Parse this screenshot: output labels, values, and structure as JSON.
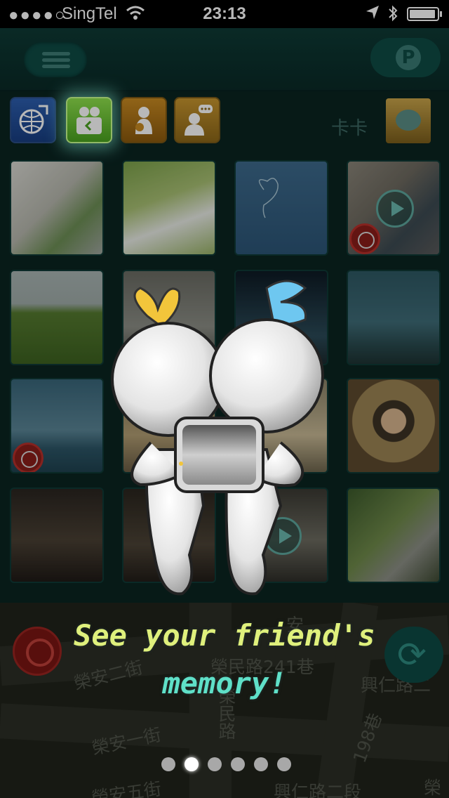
{
  "status_bar": {
    "signal": "●●●●○",
    "carrier": "SingTel",
    "time": "23:13"
  },
  "header": {
    "username": "卡卡"
  },
  "tabs": [
    {
      "name": "world"
    },
    {
      "name": "friends",
      "selected": true
    },
    {
      "name": "profile"
    },
    {
      "name": "chat"
    }
  ],
  "map": {
    "streets": [
      "榮安二街",
      "榮民路241巷",
      "興仁路二",
      "榮安一街",
      "榮民路",
      "198巷",
      "榮安五街",
      "興仁路二段",
      "安",
      "榮"
    ]
  },
  "tutorial": {
    "line1": "See your friend's",
    "line2": "memory!",
    "page_count": 6,
    "current_page": 2
  },
  "colors": {
    "accent_teal": "#0e4b45",
    "selected_tab": "#8fe24d",
    "tagline_yellow": "#dff07c",
    "tagline_cyan": "#5fe0c8"
  }
}
